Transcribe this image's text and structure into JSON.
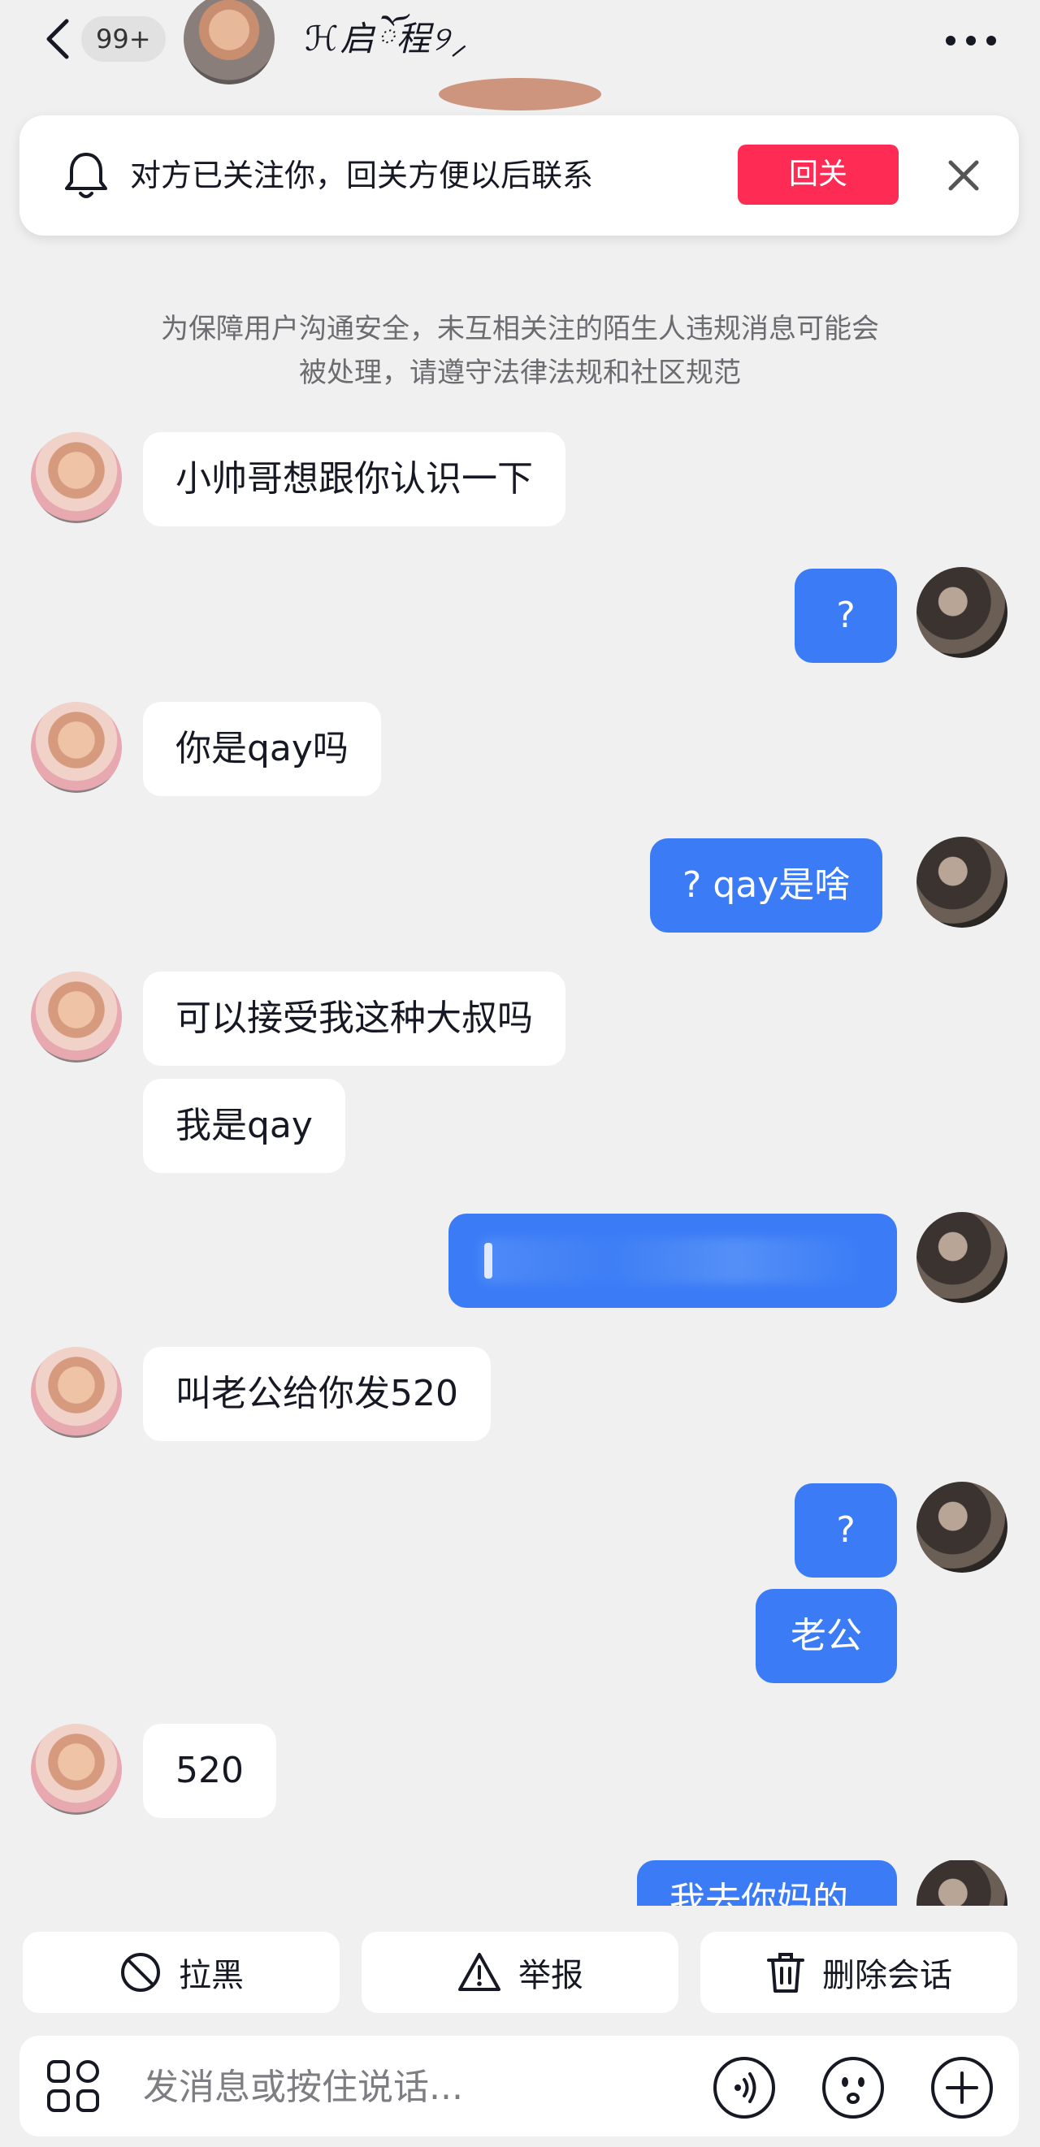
{
  "header": {
    "unread_count": "99+",
    "contact_name": "ℋ启ོ程୨⸝"
  },
  "follow_banner": {
    "text": "对方已关注你，回关方便以后联系",
    "follow_back_label": "回关"
  },
  "notice": {
    "line1": "为保障用户沟通安全，未互相关注的陌生人违规消息可能会",
    "line2": "被处理，请遵守法律法规和社区规范"
  },
  "messages": [
    {
      "side": "left",
      "text": "小帅哥想跟你认识一下"
    },
    {
      "side": "right",
      "text": "?"
    },
    {
      "side": "left",
      "text": "你是qay吗"
    },
    {
      "side": "right",
      "text": "? qay是啥"
    },
    {
      "side": "left",
      "text": "可以接受我这种大叔吗"
    },
    {
      "side": "left",
      "text": "我是qay"
    },
    {
      "side": "right",
      "text": ""
    },
    {
      "side": "left",
      "text": "叫老公给你发520"
    },
    {
      "side": "right",
      "text": "?"
    },
    {
      "side": "right",
      "text": "老公"
    },
    {
      "side": "left",
      "text": "520"
    },
    {
      "side": "right",
      "text": "我去你妈的"
    }
  ],
  "actions": {
    "block_label": "拉黑",
    "report_label": "举报",
    "delete_label": "删除会话"
  },
  "input": {
    "placeholder": "发消息或按住说话..."
  },
  "colors": {
    "accent_red": "#fe2c55",
    "bubble_blue": "#3b7cf6",
    "background": "#f1f0f1"
  },
  "icons": [
    "back-icon",
    "bell-icon",
    "close-icon",
    "more-icon",
    "block-icon",
    "warning-icon",
    "trash-icon",
    "apps-icon",
    "voice-icon",
    "emoji-icon",
    "plus-icon"
  ]
}
